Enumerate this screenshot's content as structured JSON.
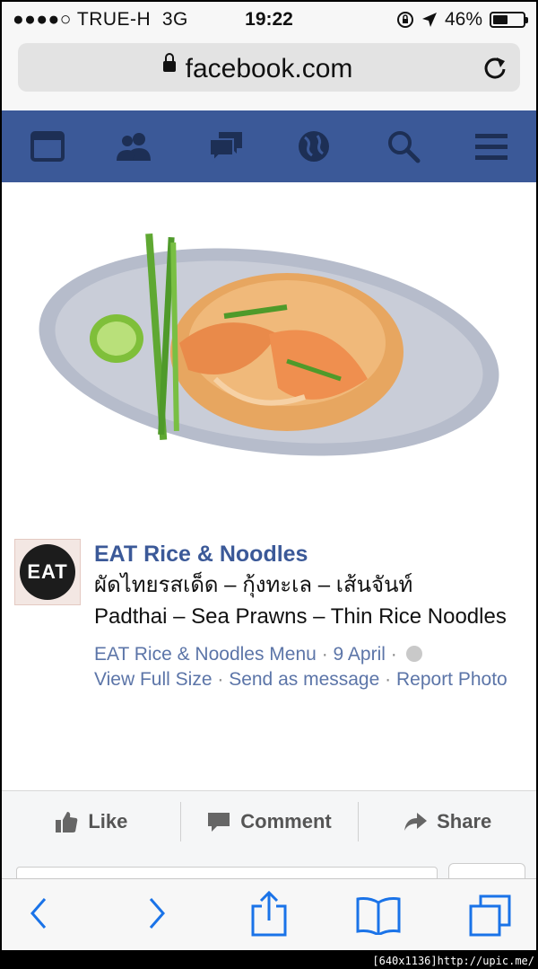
{
  "status_bar": {
    "carrier": "●●●●○ TRUE-H",
    "network": "3G",
    "time": "19:22",
    "battery": "46%",
    "battery_level": 0.46
  },
  "url_bar": {
    "domain": "facebook.com"
  },
  "fb_nav": {
    "color": "#3b5998",
    "icons": [
      "news-feed-icon",
      "friends-icon",
      "messages-icon",
      "notifications-globe-icon",
      "search-icon",
      "menu-icon"
    ]
  },
  "post": {
    "avatar_text": "EAT",
    "page_name": "EAT Rice & Noodles",
    "caption_thai": "ผัดไทยรสเด็ด – กุ้งทะเล – เส้นจันท์",
    "caption_english": "Padthai – Sea Prawns – Thin Rice Noodles",
    "album": "EAT Rice & Noodles Menu",
    "sep": "·",
    "date": "9 April",
    "link_view_full_size": "View Full Size",
    "link_send_as_message": "Send as message",
    "link_report_photo": "Report Photo"
  },
  "actions": {
    "like": "Like",
    "comment": "Comment",
    "share": "Share"
  },
  "watermark": "[640x1136]http://upic.me/"
}
